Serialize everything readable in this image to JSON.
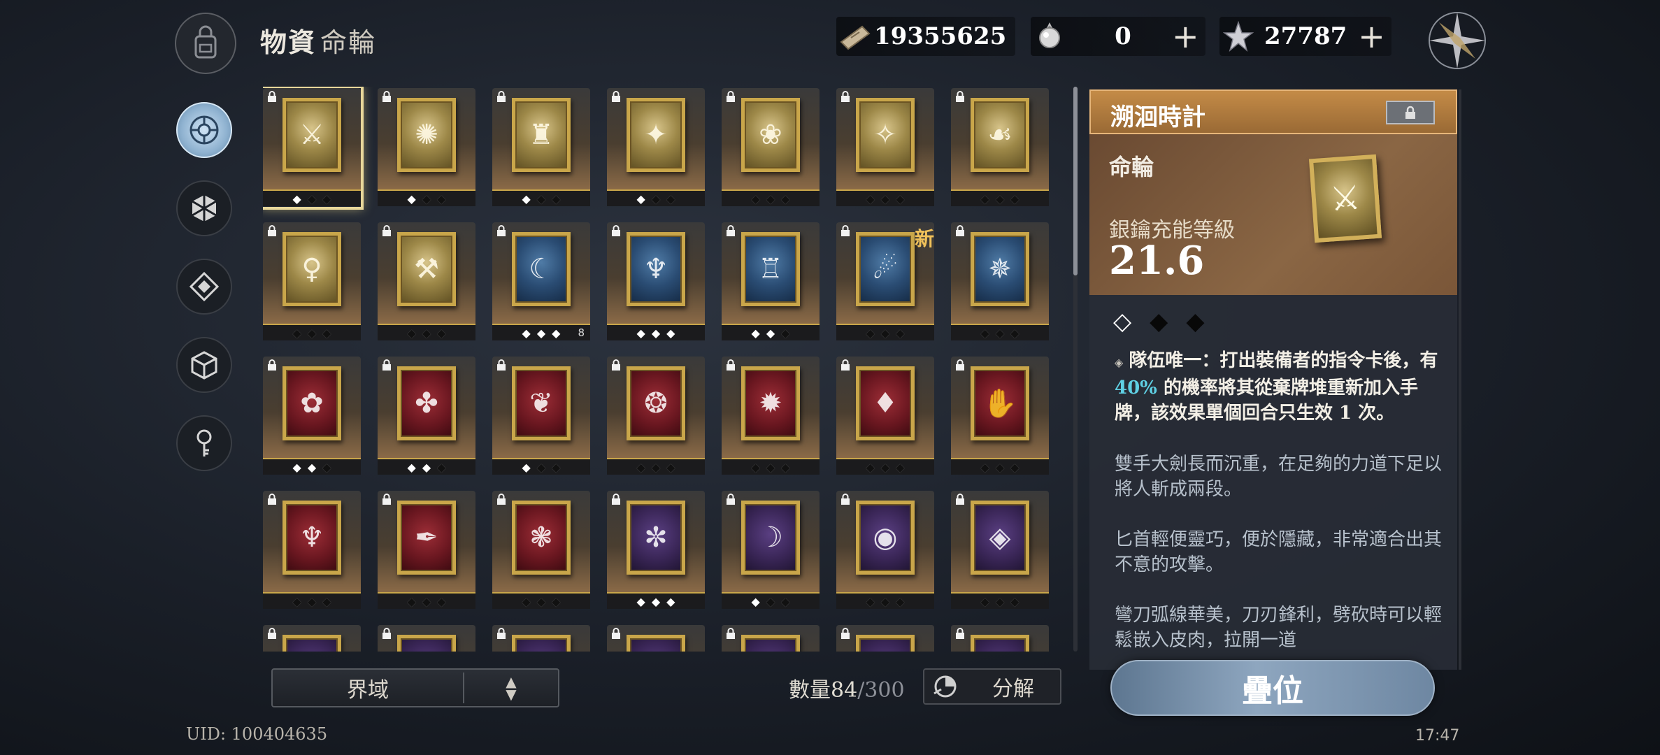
{
  "header": {
    "title": "物資",
    "subtitle": "命輪",
    "resources": [
      {
        "icon": "ticket-icon",
        "value": "19355625",
        "has_plus": false
      },
      {
        "icon": "crystal-orb-icon",
        "value": "0",
        "has_plus": true
      },
      {
        "icon": "star-shard-icon",
        "value": "27787",
        "has_plus": true
      }
    ]
  },
  "nav": [
    {
      "name": "nav-wheel",
      "icon": "wheel-icon",
      "active": true
    },
    {
      "name": "nav-hexagon",
      "icon": "hexagon-icon",
      "active": false
    },
    {
      "name": "nav-diamond",
      "icon": "diamond-icon",
      "active": false
    },
    {
      "name": "nav-cube",
      "icon": "cube-icon",
      "active": false
    },
    {
      "name": "nav-key",
      "icon": "key-icon",
      "active": false
    }
  ],
  "grid": {
    "rows": [
      [
        {
          "theme": "gold",
          "motif": "⚔",
          "stars": 1,
          "selected": true
        },
        {
          "theme": "gold",
          "motif": "✺",
          "stars": 1
        },
        {
          "theme": "gold",
          "motif": "♜",
          "stars": 1
        },
        {
          "theme": "gold",
          "motif": "✦",
          "stars": 1
        },
        {
          "theme": "gold",
          "motif": "❀",
          "stars": 0
        },
        {
          "theme": "gold",
          "motif": "✧",
          "stars": 0
        },
        {
          "theme": "gold",
          "motif": "☙",
          "stars": 0
        }
      ],
      [
        {
          "theme": "gold",
          "motif": "♀",
          "stars": 0
        },
        {
          "theme": "gold",
          "motif": "⚒",
          "stars": 0
        },
        {
          "theme": "blue",
          "motif": "☾",
          "stars": 3,
          "count": "8"
        },
        {
          "theme": "blue",
          "motif": "♆",
          "stars": 3
        },
        {
          "theme": "blue",
          "motif": "♖",
          "stars": 2
        },
        {
          "theme": "blue",
          "motif": "☄",
          "stars": 0,
          "new": true
        },
        {
          "theme": "blue",
          "motif": "✵",
          "stars": 0
        }
      ],
      [
        {
          "theme": "red",
          "motif": "✿",
          "stars": 2
        },
        {
          "theme": "red",
          "motif": "✤",
          "stars": 2
        },
        {
          "theme": "red",
          "motif": "❦",
          "stars": 1
        },
        {
          "theme": "red",
          "motif": "❂",
          "stars": 0
        },
        {
          "theme": "red",
          "motif": "✹",
          "stars": 0
        },
        {
          "theme": "red",
          "motif": "♦",
          "stars": 0
        },
        {
          "theme": "red",
          "motif": "✋",
          "stars": 0
        }
      ],
      [
        {
          "theme": "red",
          "motif": "♆",
          "stars": 0
        },
        {
          "theme": "red",
          "motif": "✒",
          "stars": 0
        },
        {
          "theme": "red",
          "motif": "❃",
          "stars": 0
        },
        {
          "theme": "purple",
          "motif": "✼",
          "stars": 3
        },
        {
          "theme": "purple",
          "motif": "☽",
          "stars": 1
        },
        {
          "theme": "purple",
          "motif": "◉",
          "stars": 0
        },
        {
          "theme": "purple",
          "motif": "◈",
          "stars": 0
        }
      ],
      [
        {
          "theme": "purple",
          "motif": "✦",
          "stars": 0
        },
        {
          "theme": "purple",
          "motif": "✦",
          "stars": 0
        },
        {
          "theme": "purple",
          "motif": "✦",
          "stars": 0
        },
        {
          "theme": "purple",
          "motif": "✦",
          "stars": 0
        },
        {
          "theme": "purple",
          "motif": "✦",
          "stars": 0
        },
        {
          "theme": "purple",
          "motif": "✦",
          "stars": 0
        },
        {
          "theme": "purple",
          "motif": "✦",
          "stars": 0
        }
      ]
    ],
    "new_label": "新"
  },
  "footer": {
    "filter_label": "界域",
    "count_label": "數量84",
    "count_max": "/300",
    "dismantle_label": "分解",
    "uid": "UID: 100404635",
    "clock": "17:47"
  },
  "detail": {
    "name": "溯洄時計",
    "type": "命輪",
    "level_label": "銀鑰充能等級",
    "level": "21.6",
    "stars": 1,
    "stars_total": 3,
    "desc_pre": "隊伍唯一：打出裝備者的指令卡後，有 ",
    "desc_highlight": "40%",
    "desc_post": " 的機率將其從棄牌堆重新加入手牌，該效果單個回合只生效 1 次。",
    "lore": [
      "雙手大劍長而沉重，在足夠的力道下足以將人斬成兩段。",
      "匕首輕便靈巧，便於隱藏，非常適合出其不意的攻擊。",
      "彎刀弧線華美，刀刃鋒利，劈砍時可以輕鬆嵌入皮肉，拉開一道"
    ],
    "stack_label": "疊位"
  },
  "colors": {
    "gold_frame": "#c9a64a",
    "header_orange": "#c48b47",
    "highlight_cyan": "#5fd0e4",
    "new_tag": "#f0c15a"
  }
}
